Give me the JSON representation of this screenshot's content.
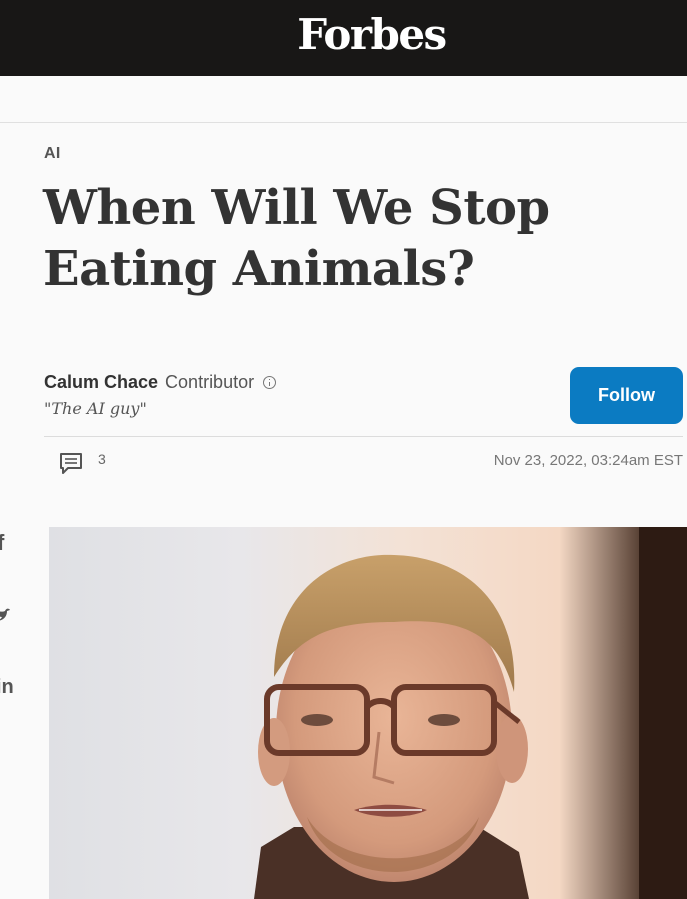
{
  "header": {
    "logo": "Forbes"
  },
  "article": {
    "category": "AI",
    "headline_line1": "When Will We Stop",
    "headline_line2": "Eating Animals?",
    "author": {
      "name": "Calum Chace",
      "role": "Contributor",
      "tagline": "\"The AI guy\""
    },
    "follow_label": "Follow",
    "comment_count": "3",
    "timestamp": "Nov 23, 2022, 03:24am EST"
  },
  "share": {
    "facebook_glyph": "f",
    "linkedin_glyph": "in"
  },
  "colors": {
    "topbar": "#181716",
    "follow": "#0b7bc2",
    "background": "#fafafa"
  },
  "icons": [
    "info-icon",
    "comment-icon",
    "facebook-icon",
    "twitter-icon",
    "linkedin-icon"
  ]
}
